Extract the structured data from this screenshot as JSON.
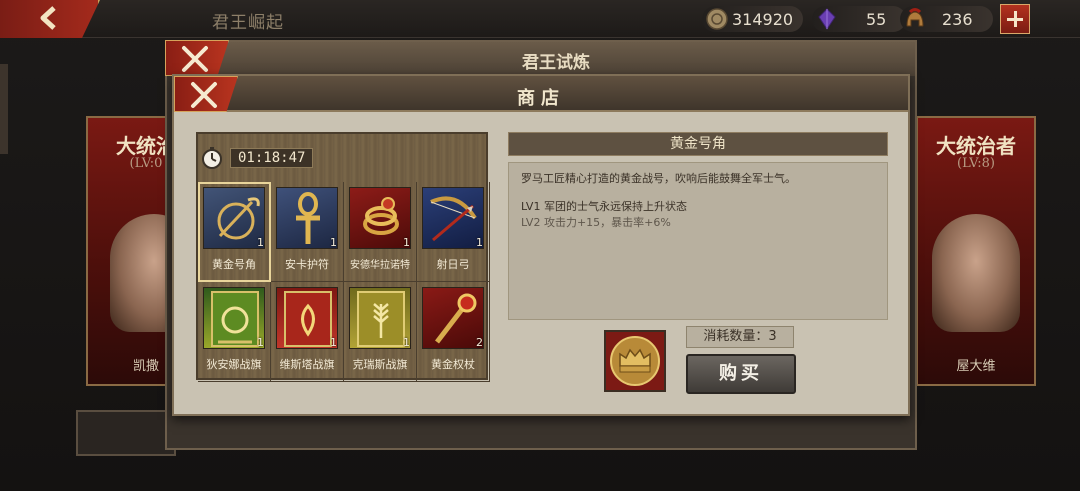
{
  "topbar": {
    "title": "君王崛起",
    "resources": [
      {
        "icon": "coin-icon",
        "value": "314920"
      },
      {
        "icon": "gem-icon",
        "value": "55"
      },
      {
        "icon": "helmet-icon",
        "value": "236"
      }
    ]
  },
  "side_cards": [
    {
      "title": "大统治",
      "level": "(LV:0",
      "name": "凯撒"
    },
    {
      "title": "大统治者",
      "level": "(LV:8)",
      "name": "屋大维"
    }
  ],
  "back_dialog": {
    "title": "君王试炼"
  },
  "shop": {
    "title": "商店",
    "timer": "01:18:47",
    "items": [
      {
        "name": "黄金号角",
        "count": "1",
        "icon": "horn-icon",
        "selected": true
      },
      {
        "name": "安卡护符",
        "count": "1",
        "icon": "ankh-icon"
      },
      {
        "name": "安德华拉诺特",
        "count": "1",
        "icon": "serpent-ring-icon"
      },
      {
        "name": "射日弓",
        "count": "1",
        "icon": "bow-icon"
      },
      {
        "name": "狄安娜战旗",
        "count": "1",
        "icon": "diana-banner-icon"
      },
      {
        "name": "维斯塔战旗",
        "count": "1",
        "icon": "vesta-banner-icon"
      },
      {
        "name": "克瑞斯战旗",
        "count": "1",
        "icon": "ceres-banner-icon"
      },
      {
        "name": "黄金权杖",
        "count": "2",
        "icon": "scepter-icon"
      }
    ],
    "detail": {
      "title": "黄金号角",
      "description": "罗马工匠精心打造的黄金战号，吹响后能鼓舞全军士气。",
      "lv1": "LV1 军团的士气永远保持上升状态",
      "lv2": "LV2 攻击力+15，暴击率+6%"
    },
    "cost": {
      "label": "消耗数量：3",
      "icon": "crown-token-icon"
    },
    "buy_label": "购买"
  }
}
